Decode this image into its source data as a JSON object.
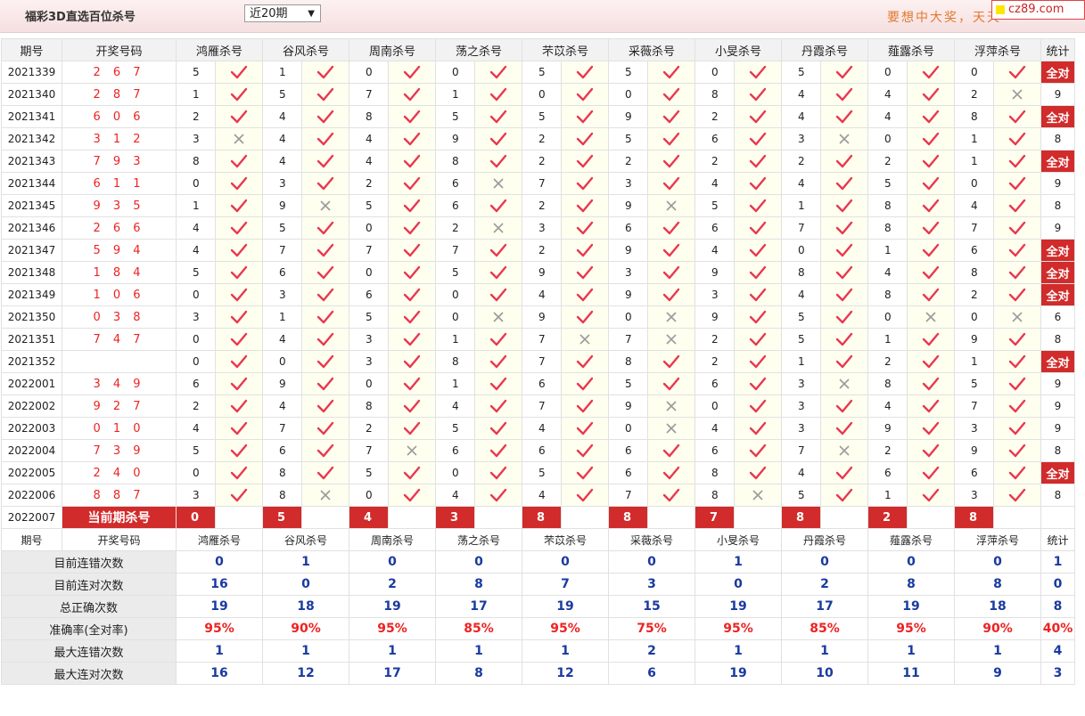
{
  "header": {
    "title": "福彩3D直选百位杀号",
    "period_select": "近20期",
    "slogan": "要想中大奖，天天",
    "logo": "cz89.com"
  },
  "columns": {
    "period": "期号",
    "draw": "开奖号码",
    "experts": [
      "鸿雁杀号",
      "谷风杀号",
      "周南杀号",
      "荡之杀号",
      "芣苡杀号",
      "采薇杀号",
      "小旻杀号",
      "丹霞杀号",
      "薤露杀号",
      "浮萍杀号"
    ],
    "stat": "统计"
  },
  "rows": [
    {
      "period": "2021339",
      "draw": "2 6 7",
      "picks": [
        [
          5,
          1
        ],
        [
          1,
          1
        ],
        [
          0,
          1
        ],
        [
          0,
          1
        ],
        [
          5,
          1
        ],
        [
          5,
          1
        ],
        [
          0,
          1
        ],
        [
          5,
          1
        ],
        [
          0,
          1
        ],
        [
          0,
          1
        ]
      ],
      "stat": "全对"
    },
    {
      "period": "2021340",
      "draw": "2 8 7",
      "picks": [
        [
          1,
          1
        ],
        [
          5,
          1
        ],
        [
          7,
          1
        ],
        [
          1,
          1
        ],
        [
          0,
          1
        ],
        [
          0,
          1
        ],
        [
          8,
          1
        ],
        [
          4,
          1
        ],
        [
          4,
          1
        ],
        [
          2,
          0
        ]
      ],
      "stat": "9"
    },
    {
      "period": "2021341",
      "draw": "6 0 6",
      "picks": [
        [
          2,
          1
        ],
        [
          4,
          1
        ],
        [
          8,
          1
        ],
        [
          5,
          1
        ],
        [
          5,
          1
        ],
        [
          9,
          1
        ],
        [
          2,
          1
        ],
        [
          4,
          1
        ],
        [
          4,
          1
        ],
        [
          8,
          1
        ]
      ],
      "stat": "全对"
    },
    {
      "period": "2021342",
      "draw": "3 1 2",
      "picks": [
        [
          3,
          0
        ],
        [
          4,
          1
        ],
        [
          4,
          1
        ],
        [
          9,
          1
        ],
        [
          2,
          1
        ],
        [
          5,
          1
        ],
        [
          6,
          1
        ],
        [
          3,
          0
        ],
        [
          0,
          1
        ],
        [
          1,
          1
        ]
      ],
      "stat": "8"
    },
    {
      "period": "2021343",
      "draw": "7 9 3",
      "picks": [
        [
          8,
          1
        ],
        [
          4,
          1
        ],
        [
          4,
          1
        ],
        [
          8,
          1
        ],
        [
          2,
          1
        ],
        [
          2,
          1
        ],
        [
          2,
          1
        ],
        [
          2,
          1
        ],
        [
          2,
          1
        ],
        [
          1,
          1
        ]
      ],
      "stat": "全对"
    },
    {
      "period": "2021344",
      "draw": "6 1 1",
      "picks": [
        [
          0,
          1
        ],
        [
          3,
          1
        ],
        [
          2,
          1
        ],
        [
          6,
          0
        ],
        [
          7,
          1
        ],
        [
          3,
          1
        ],
        [
          4,
          1
        ],
        [
          4,
          1
        ],
        [
          5,
          1
        ],
        [
          0,
          1
        ]
      ],
      "stat": "9"
    },
    {
      "period": "2021345",
      "draw": "9 3 5",
      "picks": [
        [
          1,
          1
        ],
        [
          9,
          0
        ],
        [
          5,
          1
        ],
        [
          6,
          1
        ],
        [
          2,
          1
        ],
        [
          9,
          0
        ],
        [
          5,
          1
        ],
        [
          1,
          1
        ],
        [
          8,
          1
        ],
        [
          4,
          1
        ]
      ],
      "stat": "8"
    },
    {
      "period": "2021346",
      "draw": "2 6 6",
      "picks": [
        [
          4,
          1
        ],
        [
          5,
          1
        ],
        [
          0,
          1
        ],
        [
          2,
          0
        ],
        [
          3,
          1
        ],
        [
          6,
          1
        ],
        [
          6,
          1
        ],
        [
          7,
          1
        ],
        [
          8,
          1
        ],
        [
          7,
          1
        ]
      ],
      "stat": "9"
    },
    {
      "period": "2021347",
      "draw": "5 9 4",
      "picks": [
        [
          4,
          1
        ],
        [
          7,
          1
        ],
        [
          7,
          1
        ],
        [
          7,
          1
        ],
        [
          2,
          1
        ],
        [
          9,
          1
        ],
        [
          4,
          1
        ],
        [
          0,
          1
        ],
        [
          1,
          1
        ],
        [
          6,
          1
        ]
      ],
      "stat": "全对"
    },
    {
      "period": "2021348",
      "draw": "1 8 4",
      "picks": [
        [
          5,
          1
        ],
        [
          6,
          1
        ],
        [
          0,
          1
        ],
        [
          5,
          1
        ],
        [
          9,
          1
        ],
        [
          3,
          1
        ],
        [
          9,
          1
        ],
        [
          8,
          1
        ],
        [
          4,
          1
        ],
        [
          8,
          1
        ]
      ],
      "stat": "全对"
    },
    {
      "period": "2021349",
      "draw": "1 0 6",
      "picks": [
        [
          0,
          1
        ],
        [
          3,
          1
        ],
        [
          6,
          1
        ],
        [
          0,
          1
        ],
        [
          4,
          1
        ],
        [
          9,
          1
        ],
        [
          3,
          1
        ],
        [
          4,
          1
        ],
        [
          8,
          1
        ],
        [
          2,
          1
        ]
      ],
      "stat": "全对"
    },
    {
      "period": "2021350",
      "draw": "0 3 8",
      "picks": [
        [
          3,
          1
        ],
        [
          1,
          1
        ],
        [
          5,
          1
        ],
        [
          0,
          0
        ],
        [
          9,
          1
        ],
        [
          0,
          0
        ],
        [
          9,
          1
        ],
        [
          5,
          1
        ],
        [
          0,
          0
        ],
        [
          0,
          0
        ]
      ],
      "stat": "6"
    },
    {
      "period": "2021351",
      "draw": "7 4 7",
      "picks": [
        [
          0,
          1
        ],
        [
          4,
          1
        ],
        [
          3,
          1
        ],
        [
          1,
          1
        ],
        [
          7,
          0
        ],
        [
          7,
          0
        ],
        [
          2,
          1
        ],
        [
          5,
          1
        ],
        [
          1,
          1
        ],
        [
          9,
          1
        ]
      ],
      "stat": "8"
    },
    {
      "period": "2021352",
      "draw": "",
      "picks": [
        [
          0,
          1
        ],
        [
          0,
          1
        ],
        [
          3,
          1
        ],
        [
          8,
          1
        ],
        [
          7,
          1
        ],
        [
          8,
          1
        ],
        [
          2,
          1
        ],
        [
          1,
          1
        ],
        [
          2,
          1
        ],
        [
          1,
          1
        ]
      ],
      "stat": "全对"
    },
    {
      "period": "2022001",
      "draw": "3 4 9",
      "picks": [
        [
          6,
          1
        ],
        [
          9,
          1
        ],
        [
          0,
          1
        ],
        [
          1,
          1
        ],
        [
          6,
          1
        ],
        [
          5,
          1
        ],
        [
          6,
          1
        ],
        [
          3,
          0
        ],
        [
          8,
          1
        ],
        [
          5,
          1
        ]
      ],
      "stat": "9"
    },
    {
      "period": "2022002",
      "draw": "9 2 7",
      "picks": [
        [
          2,
          1
        ],
        [
          4,
          1
        ],
        [
          8,
          1
        ],
        [
          4,
          1
        ],
        [
          7,
          1
        ],
        [
          9,
          0
        ],
        [
          0,
          1
        ],
        [
          3,
          1
        ],
        [
          4,
          1
        ],
        [
          7,
          1
        ]
      ],
      "stat": "9"
    },
    {
      "period": "2022003",
      "draw": "0 1 0",
      "picks": [
        [
          4,
          1
        ],
        [
          7,
          1
        ],
        [
          2,
          1
        ],
        [
          5,
          1
        ],
        [
          4,
          1
        ],
        [
          0,
          0
        ],
        [
          4,
          1
        ],
        [
          3,
          1
        ],
        [
          9,
          1
        ],
        [
          3,
          1
        ]
      ],
      "stat": "9"
    },
    {
      "period": "2022004",
      "draw": "7 3 9",
      "picks": [
        [
          5,
          1
        ],
        [
          6,
          1
        ],
        [
          7,
          0
        ],
        [
          6,
          1
        ],
        [
          6,
          1
        ],
        [
          6,
          1
        ],
        [
          6,
          1
        ],
        [
          7,
          0
        ],
        [
          2,
          1
        ],
        [
          9,
          1
        ]
      ],
      "stat": "8"
    },
    {
      "period": "2022005",
      "draw": "2 4 0",
      "picks": [
        [
          0,
          1
        ],
        [
          8,
          1
        ],
        [
          5,
          1
        ],
        [
          0,
          1
        ],
        [
          5,
          1
        ],
        [
          6,
          1
        ],
        [
          8,
          1
        ],
        [
          4,
          1
        ],
        [
          6,
          1
        ],
        [
          6,
          1
        ]
      ],
      "stat": "全对"
    },
    {
      "period": "2022006",
      "draw": "8 8 7",
      "picks": [
        [
          3,
          1
        ],
        [
          8,
          0
        ],
        [
          0,
          1
        ],
        [
          4,
          1
        ],
        [
          4,
          1
        ],
        [
          7,
          1
        ],
        [
          8,
          0
        ],
        [
          5,
          1
        ],
        [
          1,
          1
        ],
        [
          3,
          1
        ]
      ],
      "stat": "8"
    }
  ],
  "current": {
    "period": "2022007",
    "label": "当前期杀号",
    "picks": [
      "0",
      "5",
      "4",
      "3",
      "8",
      "8",
      "7",
      "8",
      "2",
      "8"
    ]
  },
  "stats": [
    {
      "label": "目前连错次数",
      "values": [
        "0",
        "1",
        "0",
        "0",
        "0",
        "0",
        "1",
        "0",
        "0",
        "0"
      ],
      "total": "1",
      "style": "blue"
    },
    {
      "label": "目前连对次数",
      "values": [
        "16",
        "0",
        "2",
        "8",
        "7",
        "3",
        "0",
        "2",
        "8",
        "8"
      ],
      "total": "0",
      "style": "blue"
    },
    {
      "label": "总正确次数",
      "values": [
        "19",
        "18",
        "19",
        "17",
        "19",
        "15",
        "19",
        "17",
        "19",
        "18"
      ],
      "total": "8",
      "style": "blue"
    },
    {
      "label": "准确率(全对率)",
      "values": [
        "95%",
        "90%",
        "95%",
        "85%",
        "95%",
        "75%",
        "95%",
        "85%",
        "95%",
        "90%"
      ],
      "total": "40%",
      "style": "red"
    },
    {
      "label": "最大连错次数",
      "values": [
        "1",
        "1",
        "1",
        "1",
        "1",
        "2",
        "1",
        "1",
        "1",
        "1"
      ],
      "total": "4",
      "style": "blue"
    },
    {
      "label": "最大连对次数",
      "values": [
        "16",
        "12",
        "17",
        "8",
        "12",
        "6",
        "19",
        "10",
        "11",
        "9"
      ],
      "total": "3",
      "style": "blue"
    }
  ],
  "colors": {
    "accent": "#d12b2b",
    "check": "#e8384f",
    "cross": "#9a9a9a",
    "stat_blue": "#1a3aa0"
  }
}
